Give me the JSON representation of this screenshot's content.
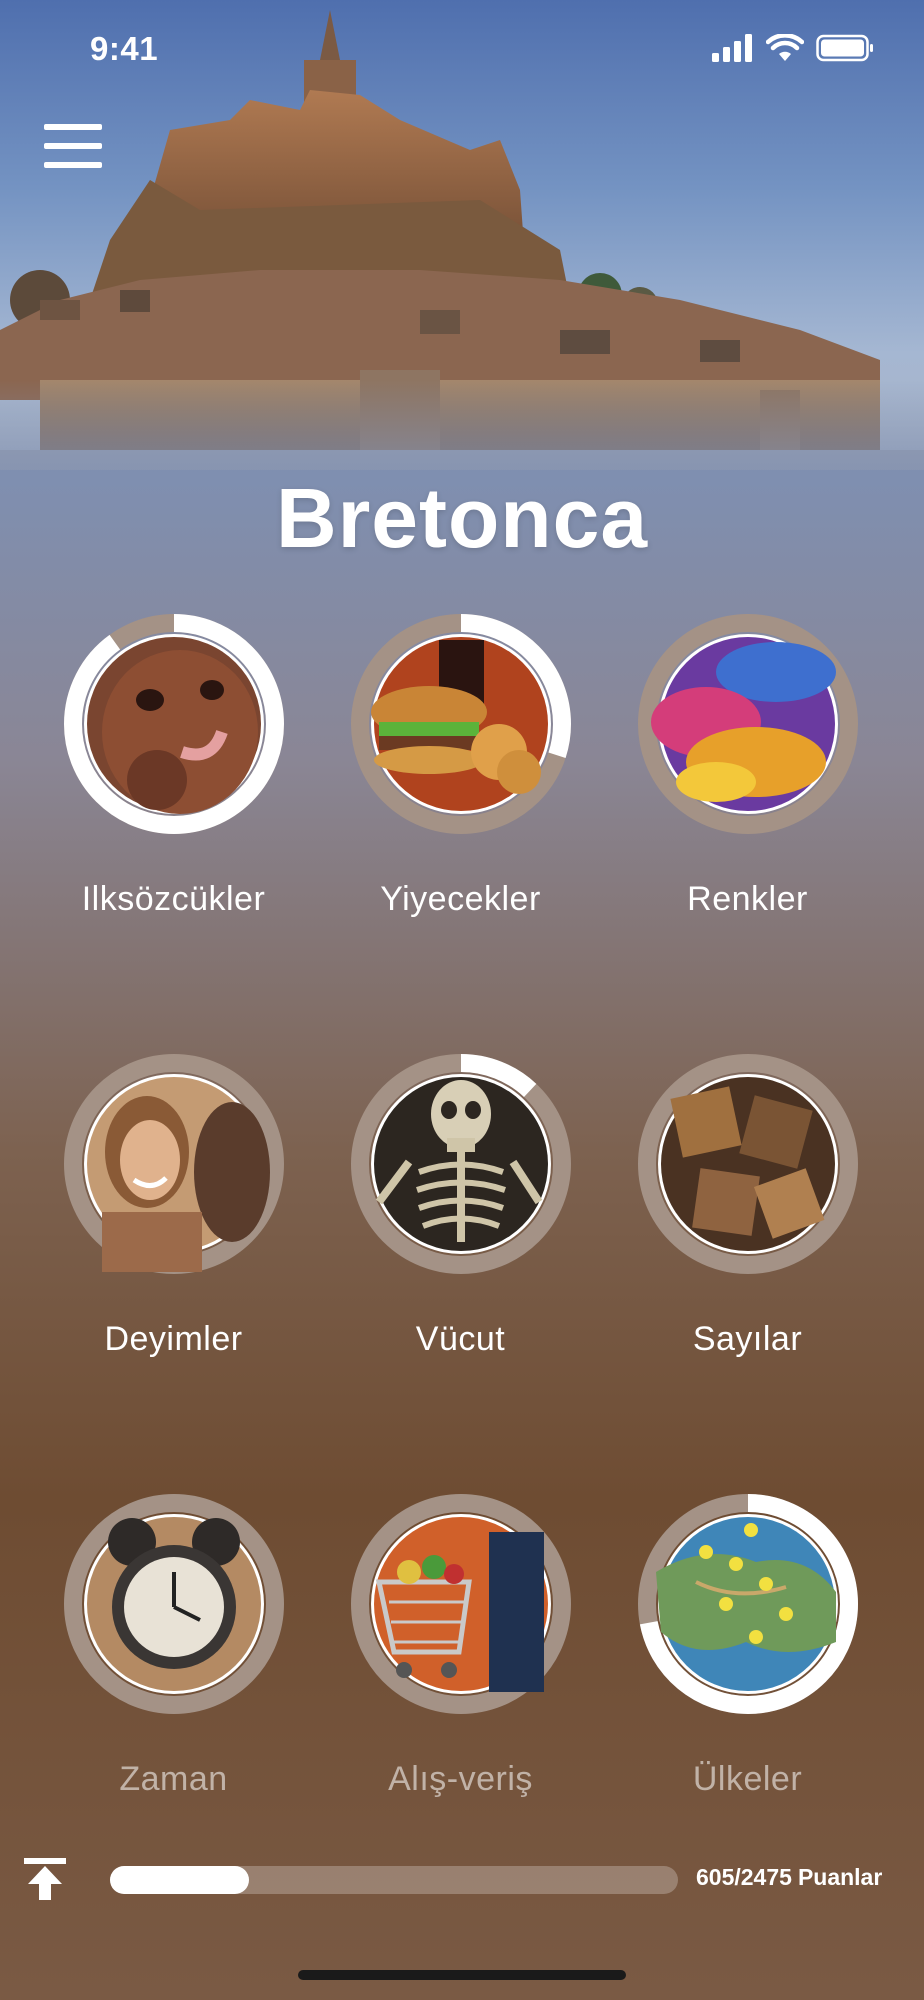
{
  "status_bar": {
    "time": "9:41"
  },
  "header": {
    "title": "Bretonca"
  },
  "topics": [
    {
      "label": "Ilksözcükler",
      "progress": 0.9,
      "image": "baby-photo",
      "dim": false
    },
    {
      "label": "Yiyecekler",
      "progress": 0.3,
      "image": "burger-fries-photo",
      "dim": false
    },
    {
      "label": "Renkler",
      "progress": 0,
      "image": "colored-powder-photo",
      "dim": false
    },
    {
      "label": "Deyimler",
      "progress": 0,
      "image": "smiling-woman-photo",
      "dim": false
    },
    {
      "label": "Vücut",
      "progress": 0.12,
      "image": "skeleton-photo",
      "dim": false
    },
    {
      "label": "Sayılar",
      "progress": 0,
      "image": "wooden-numbers-photo",
      "dim": false
    },
    {
      "label": "Zaman",
      "progress": 0,
      "image": "alarm-clock-photo",
      "dim": true
    },
    {
      "label": "Alış-veriş",
      "progress": 0,
      "image": "shopping-cart-photo",
      "dim": true
    },
    {
      "label": "Ülkeler",
      "progress": 0.72,
      "image": "map-pins-photo",
      "dim": true
    }
  ],
  "footer": {
    "points": "605/2475",
    "points_label": "Puanlar",
    "progress": 0.244
  },
  "colors": {
    "ring_track": "#a49286",
    "ring_progress": "#ffffff"
  }
}
